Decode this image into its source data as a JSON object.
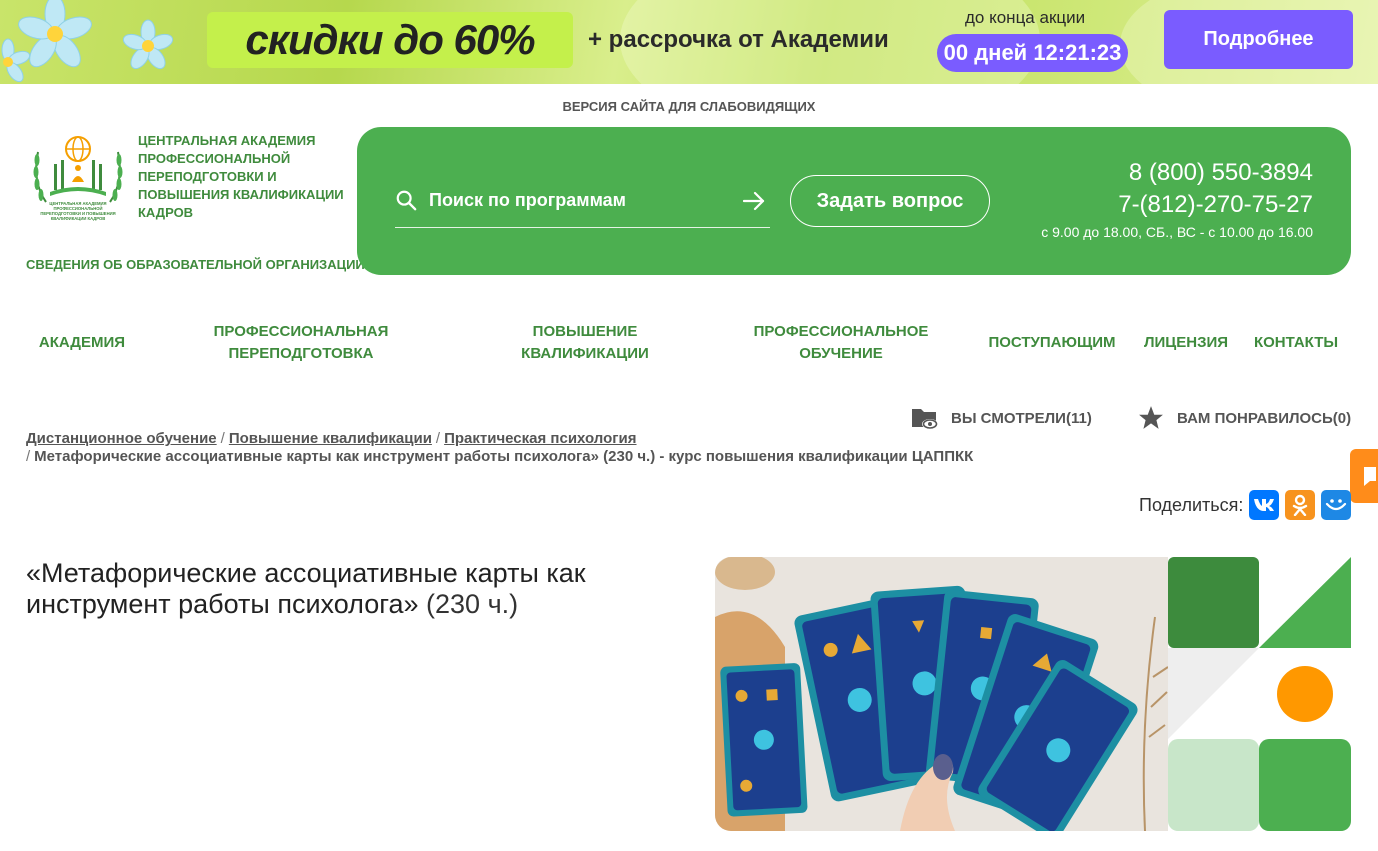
{
  "promo": {
    "discount": "скидки до 60%",
    "subtitle": "+ рассрочка от Академии",
    "until_label": "до конца акции",
    "timer": "00 дней 12:21:23",
    "button": "Подробнее"
  },
  "header": {
    "low_vision": "ВЕРСИЯ САЙТА ДЛЯ СЛАБОВИДЯЩИХ",
    "logo_title": "ЦЕНТРАЛЬНАЯ АКАДЕМИЯ ПРОФЕССИОНАЛЬНОЙ ПЕРЕПОДГОТОВКИ И ПОВЫШЕНИЯ КВАЛИФИКАЦИИ КАДРОВ",
    "logo_small_text": "ЦЕНТРАЛЬНАЯ АКАДЕМИЯ ПРОФЕССИОНАЛЬНОЙ ПЕРЕПОДГОТОВКИ И ПОВЫШЕНИЯ КВАЛИФИКАЦИИ КАДРОВ",
    "org_info": "СВЕДЕНИЯ ОБ ОБРАЗОВАТЕЛЬНОЙ ОРГАНИЗАЦИИ",
    "search_placeholder": "Поиск по программам",
    "search_value": "",
    "ask_button": "Задать вопрос",
    "phone1": "8 (800) 550-3894",
    "phone2": "7-(812)-270-75-27",
    "hours": "с 9.00 до 18.00, СБ., ВС - с 10.00 до 16.00"
  },
  "nav": [
    {
      "label": "АКАДЕМИЯ"
    },
    {
      "label": "ПРОФЕССИОНАЛЬНАЯ ПЕРЕПОДГОТОВКА"
    },
    {
      "label": "ПОВЫШЕНИЕ КВАЛИФИКАЦИИ"
    },
    {
      "label": "ПРОФЕССИОНАЛЬНОЕ ОБУЧЕНИЕ"
    },
    {
      "label": "ПОСТУПАЮЩИМ"
    },
    {
      "label": "ЛИЦЕНЗИЯ"
    },
    {
      "label": "КОНТАКТЫ"
    }
  ],
  "viewed": "ВЫ СМОТРЕЛИ(11)",
  "liked": "ВАМ ПОНРАВИЛОСЬ(0)",
  "breadcrumb": {
    "items": [
      "Дистанционное обучение",
      "Повышение квалификации",
      "Практическая психология"
    ],
    "current": "Метафорические ассоциативные карты как инструмент работы психолога» (230 ч.) - курс повышения квалификации ЦАППКК"
  },
  "share": {
    "label": "Поделиться:",
    "vk": "VK",
    "ok": "OK",
    "mm": "MM"
  },
  "course": {
    "title": "«Метафорические ассоциативные карты как инструмент работы психолога»",
    "hours": "(230 ч.)"
  },
  "colors": {
    "brand_green": "#4caf50",
    "text_green": "#3f8b3d",
    "promo_purple": "#7a5cff",
    "accent_orange": "#ff8c1a"
  }
}
